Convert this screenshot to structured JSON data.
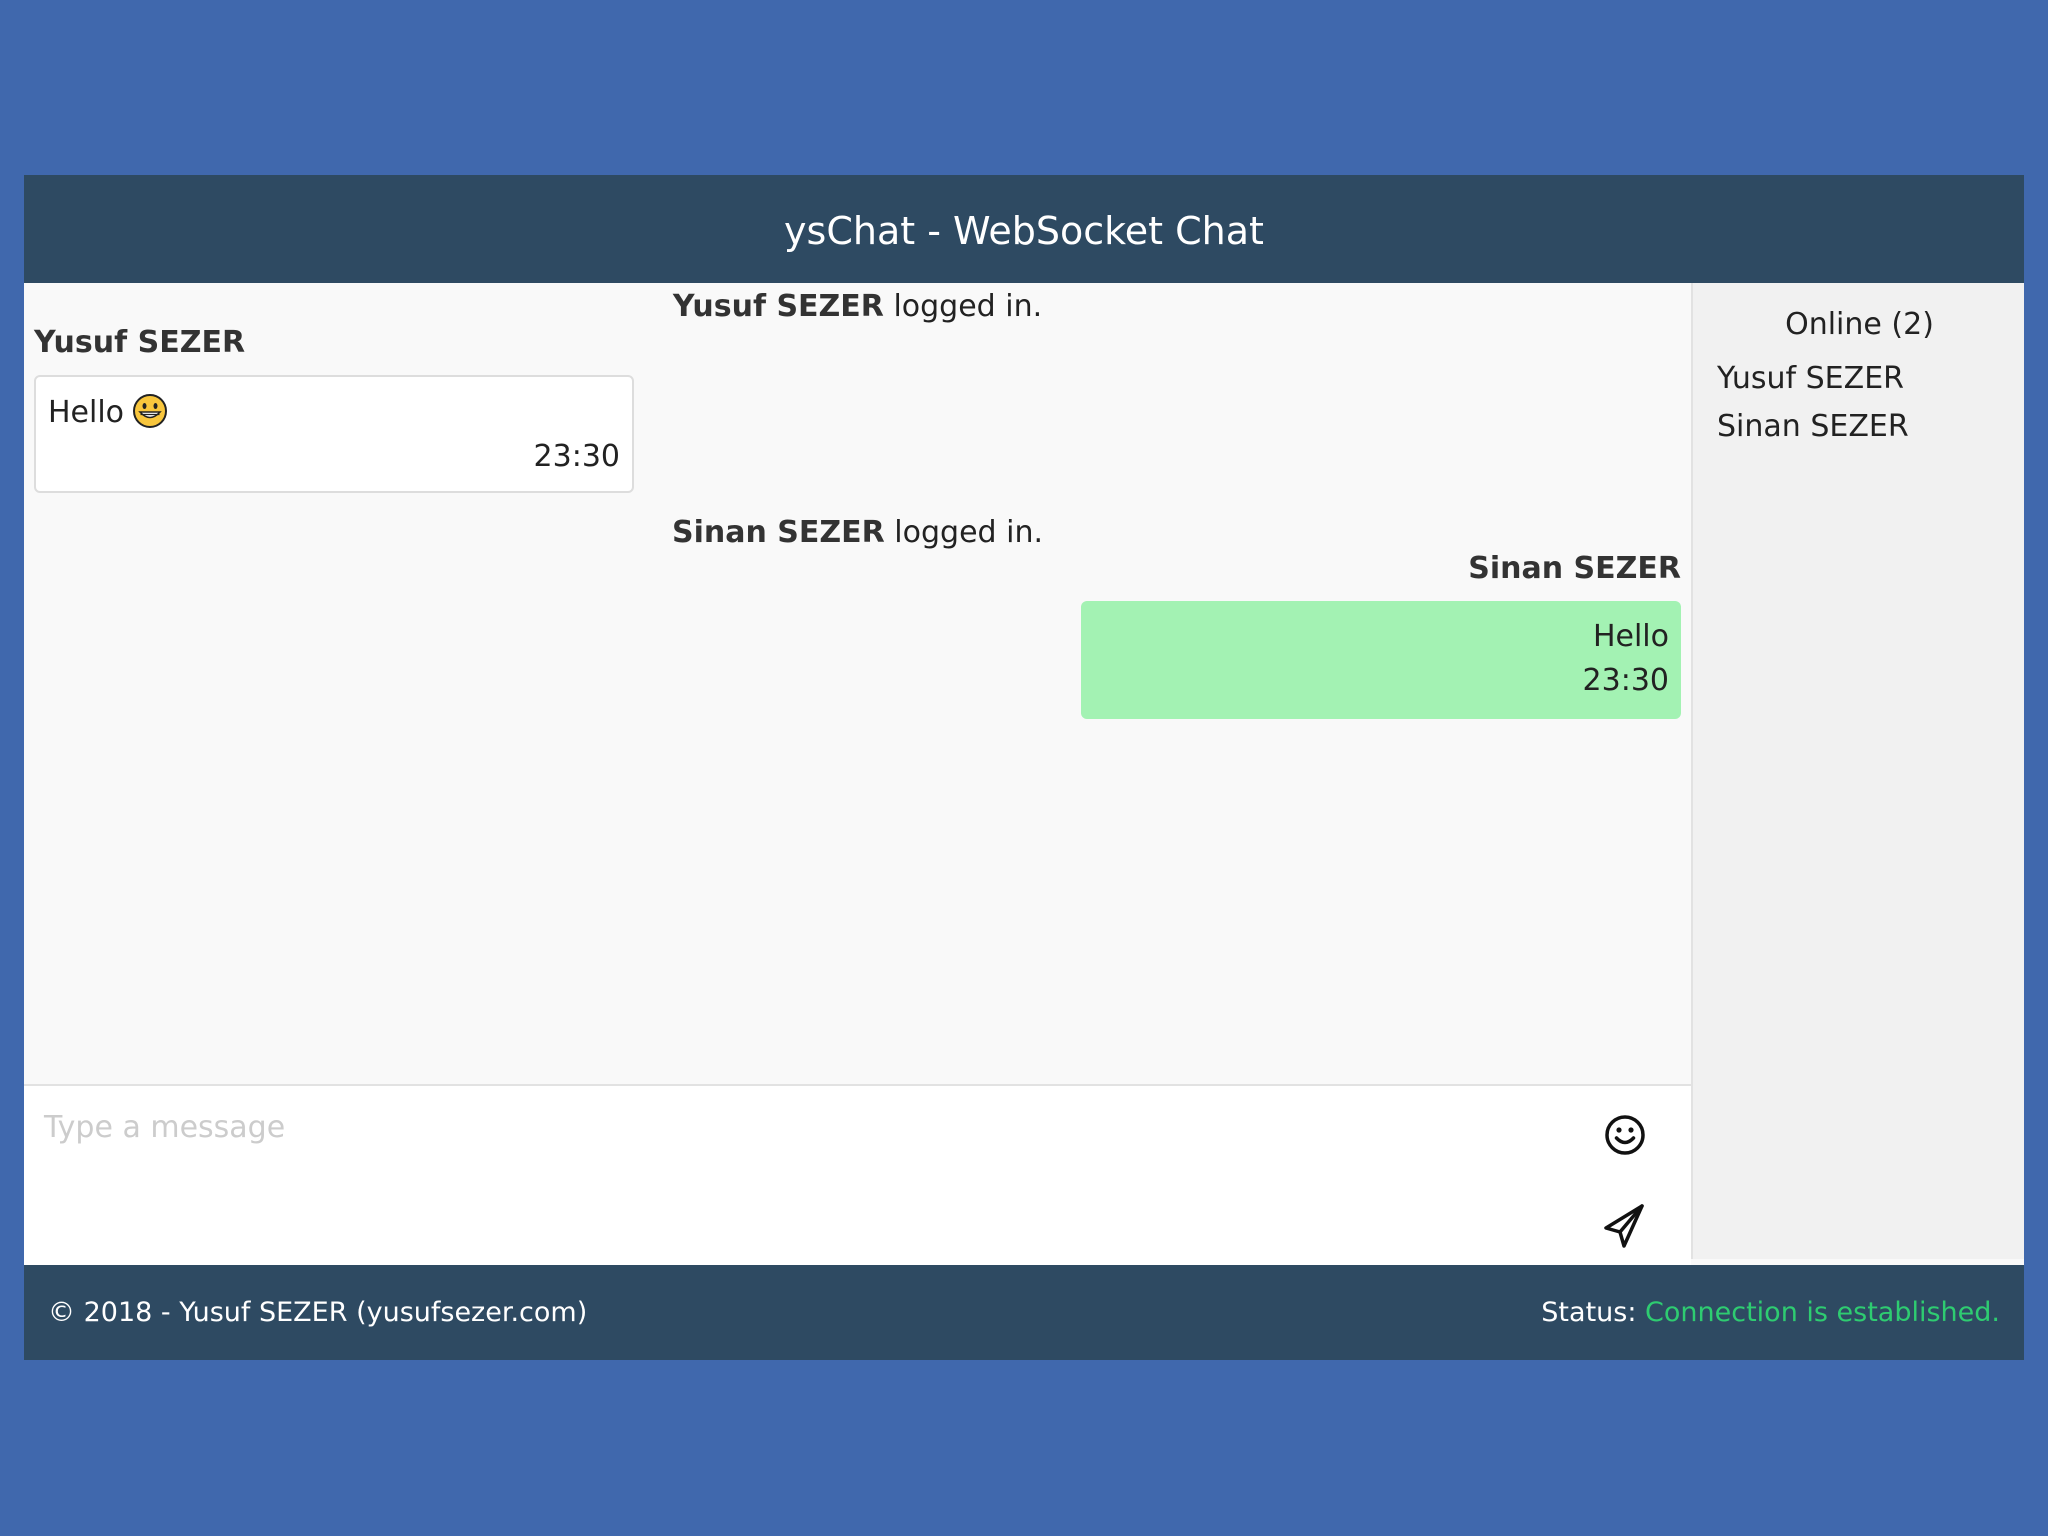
{
  "header": {
    "title": "ysChat - WebSocket Chat"
  },
  "messages": [
    {
      "type": "system",
      "user": "Yusuf SEZER",
      "text": "logged in."
    },
    {
      "type": "incoming",
      "sender": "Yusuf SEZER",
      "text": "Hello",
      "emoji": "grinning-face",
      "time": "23:30"
    },
    {
      "type": "system",
      "user": "Sinan SEZER",
      "text": "logged in."
    },
    {
      "type": "outgoing",
      "sender": "Sinan SEZER",
      "text": "Hello",
      "time": "23:30"
    }
  ],
  "composer": {
    "placeholder": "Type a message",
    "emoji_icon": "smiley-icon",
    "send_icon": "send-icon"
  },
  "sidebar": {
    "title": "Online (2)",
    "users": [
      "Yusuf SEZER",
      "Sinan SEZER"
    ]
  },
  "footer": {
    "copyright": "© 2018 - Yusuf SEZER (yusufsezer.com)",
    "status_label": "Status:",
    "status_value": "Connection is established.",
    "status_color": "#2ecc71"
  },
  "colors": {
    "background": "#4068ad",
    "header": "#2e4a62",
    "outgoing_bubble": "#a3f2b3",
    "incoming_bubble": "#ffffff"
  }
}
